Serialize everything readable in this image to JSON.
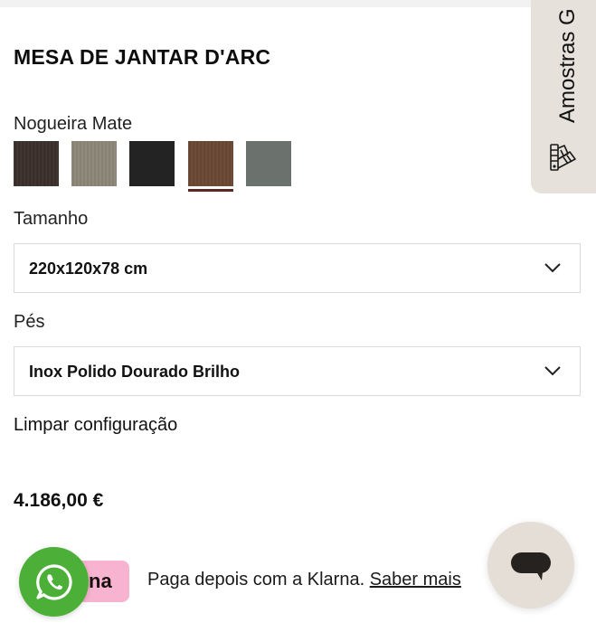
{
  "product": {
    "title": "MESA DE JANTAR D'ARC"
  },
  "finish": {
    "label": "Nogueira Mate",
    "swatches": [
      {
        "name": "dark-wood",
        "color": "#3b2f2a",
        "selected": false
      },
      {
        "name": "taupe",
        "color": "#8f887a",
        "selected": false
      },
      {
        "name": "black",
        "color": "#232323",
        "selected": false
      },
      {
        "name": "walnut-matte",
        "color": "#6b4733",
        "selected": true
      },
      {
        "name": "grey-green",
        "color": "#6b716c",
        "selected": false
      }
    ]
  },
  "size": {
    "label": "Tamanho",
    "value": "220x120x78 cm"
  },
  "legs": {
    "label": "Pés",
    "value": "Inox Polido Dourado Brilho"
  },
  "actions": {
    "clear_config": "Limpar configuração"
  },
  "price": "4.186,00 €",
  "klarna": {
    "badge_text": "na",
    "text": "Paga depois com a Klarna.",
    "link": "Saber mais",
    "badge_color": "#f7b3cf"
  },
  "samples_tab": {
    "label": "Amostras G"
  },
  "icons": {
    "whatsapp": "whatsapp-icon",
    "chat": "chat-bubble-icon",
    "samples": "color-fan-icon",
    "dropdown": "chevron-down-icon"
  }
}
